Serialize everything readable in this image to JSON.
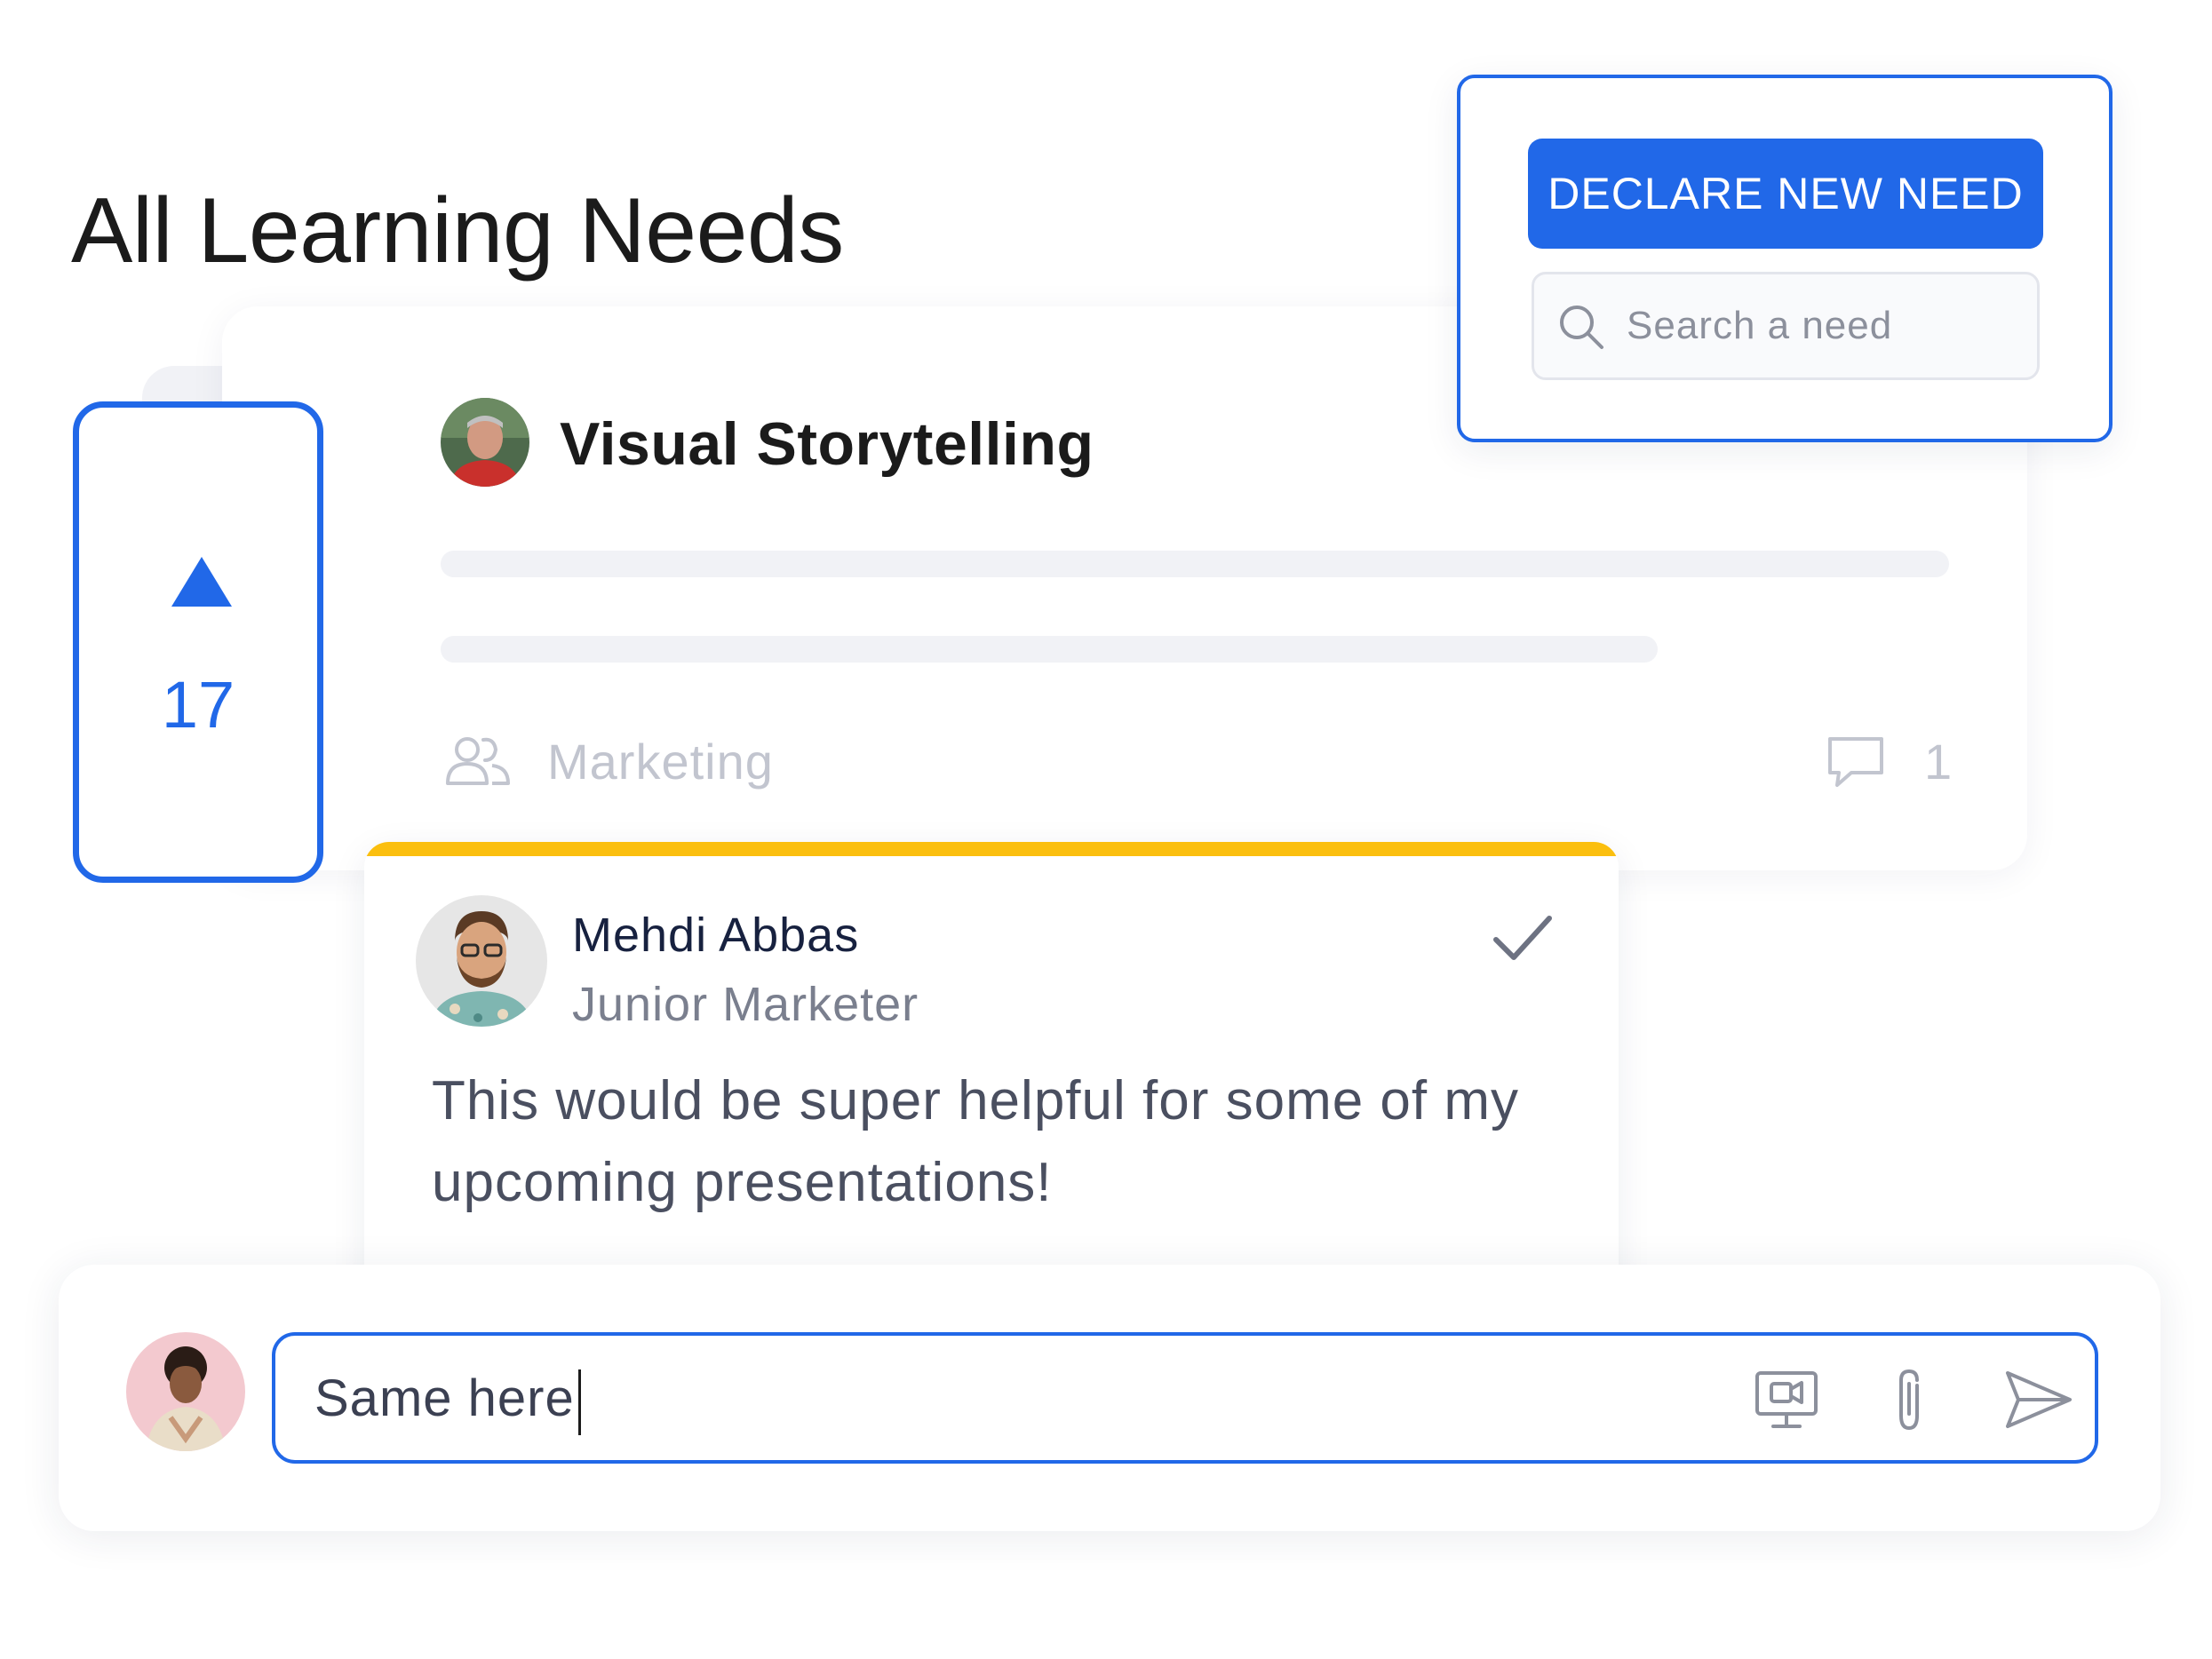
{
  "page": {
    "title": "All Learning Needs"
  },
  "declare_panel": {
    "button_label": "DECLARE NEW NEED",
    "search_placeholder": "Search a need"
  },
  "need": {
    "upvote_count": "17",
    "title": "Visual Storytelling",
    "team": "Marketing",
    "comment_count": "1"
  },
  "comment": {
    "author_name": "Mehdi Abbas",
    "author_role": "Junior Marketer",
    "text": "This would be super helpful for some of my upcoming presentations!",
    "accent_color": "#fbbf0f"
  },
  "reply": {
    "value": "Same here"
  },
  "colors": {
    "primary": "#2168e8",
    "muted_text": "#c2c5cf",
    "skeleton": "#f1f2f6"
  },
  "icons": {
    "upvote": "triangle-up-icon",
    "team": "users-icon",
    "comment": "speech-bubble-icon",
    "search": "magnifier-icon",
    "check": "check-icon",
    "screen_record": "screen-record-icon",
    "attach": "paperclip-icon",
    "send": "send-icon"
  }
}
